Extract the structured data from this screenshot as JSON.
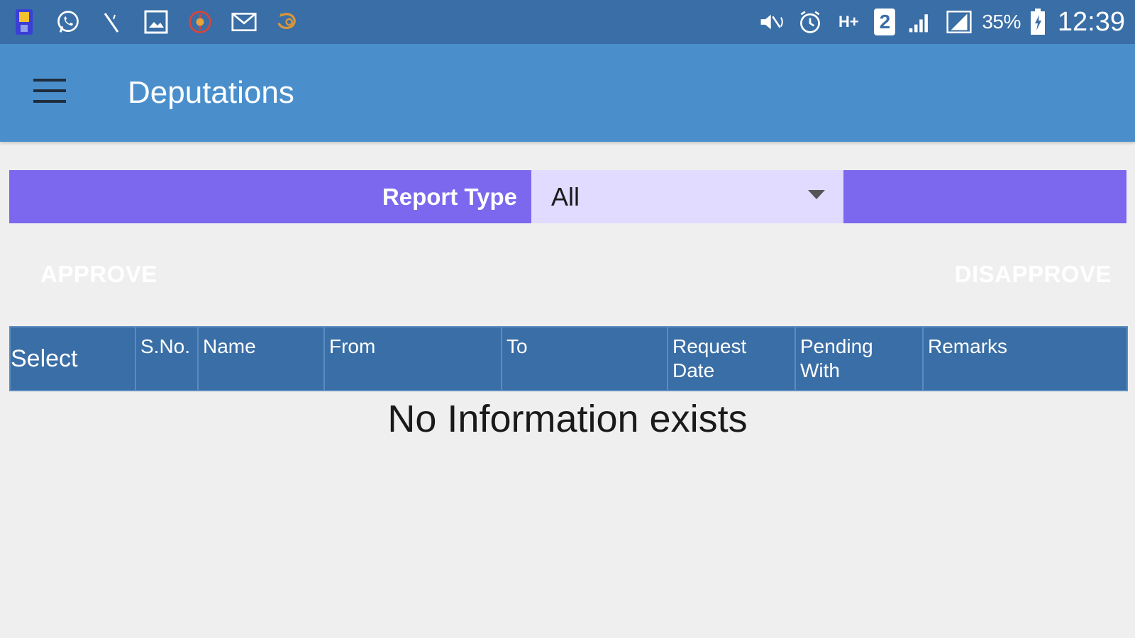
{
  "status_bar": {
    "battery_percent": "35%",
    "time": "12:39",
    "sim_badge": "2",
    "network_type": "H+",
    "left_icons": [
      "sim-card-icon",
      "whatsapp-icon",
      "phone-icon",
      "gallery-icon",
      "app-icon",
      "mail-icon",
      "sync-icon"
    ],
    "right_icons": [
      "mute-icon",
      "alarm-icon",
      "network-hplus-icon",
      "sim-2-icon",
      "signal-icon",
      "signal-icon",
      "battery-charging-icon"
    ]
  },
  "app_bar": {
    "title": "Deputations",
    "menu_icon": "hamburger-menu-icon"
  },
  "filter": {
    "label": "Report Type",
    "selected": "All"
  },
  "actions": {
    "approve_label": "APPROVE",
    "disapprove_label": "DISAPPROVE"
  },
  "table": {
    "columns": [
      "Select",
      "S.No.",
      "Name",
      "From",
      "To",
      "Request Date",
      "Pending With",
      "Remarks"
    ],
    "rows": [],
    "empty_message": "No Information exists"
  },
  "colors": {
    "status_bar": "#3a6ea6",
    "app_bar": "#4a8fcc",
    "filter_accent": "#7b68ee",
    "filter_select_bg": "#e0dbff",
    "table_header": "#3a6ea6",
    "background": "#efefef"
  }
}
